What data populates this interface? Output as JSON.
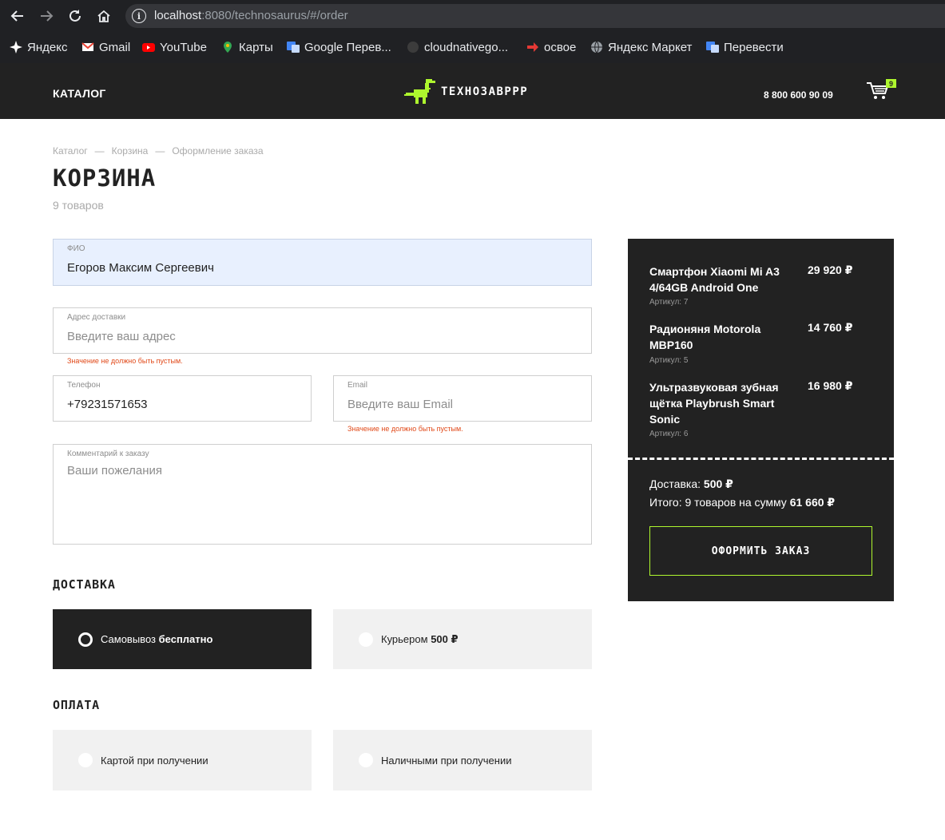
{
  "browser": {
    "url_host": "localhost",
    "url_rest": ":8080/technosaurus/#/order",
    "bookmarks": [
      "Яндекс",
      "Gmail",
      "YouTube",
      "Карты",
      "Google Перев...",
      "cloudnativego...",
      "освое",
      "Яндекс Маркет",
      "Перевести"
    ]
  },
  "header": {
    "catalog": "КАТАЛОГ",
    "logo_text": "ТЕХНОЗАВРРР",
    "phone": "8 800 600 90 09",
    "cart_count": "9"
  },
  "breadcrumb": [
    "Каталог",
    "Корзина",
    "Оформление заказа"
  ],
  "breadcrumb_sep": "—",
  "page": {
    "title": "КОРЗИНА",
    "count": "9 товаров"
  },
  "form": {
    "fio": {
      "label": "ФИО",
      "value": "Егоров Максим Сергеевич",
      "placeholder": ""
    },
    "address": {
      "label": "Адрес доставки",
      "value": "",
      "placeholder": "Введите ваш адрес",
      "error": "Значение не должно быть пустым."
    },
    "phone": {
      "label": "Телефон",
      "value": "+79231571653",
      "placeholder": ""
    },
    "email": {
      "label": "Email",
      "value": "",
      "placeholder": "Введите ваш Email",
      "error": "Значение не должно быть пустым."
    },
    "comment": {
      "label": "Комментарий к заказу",
      "value": "",
      "placeholder": "Ваши пожелания"
    }
  },
  "delivery": {
    "title": "ДОСТАВКА",
    "options": [
      {
        "label": "Самовывоз",
        "price": "бесплатно",
        "selected": true
      },
      {
        "label": "Курьером",
        "price": "500 ₽",
        "selected": false
      }
    ]
  },
  "payment": {
    "title": "ОПЛАТА",
    "options": [
      {
        "label": "Картой при получении",
        "selected": false
      },
      {
        "label": "Наличными при получении",
        "selected": false
      }
    ]
  },
  "summary": {
    "items": [
      {
        "name": "Смартфон Xiaomi Mi A3 4/64GB Android One",
        "price": "29 920 ₽",
        "article": "Артикул: 7"
      },
      {
        "name": "Радионяня Motorola MBP160",
        "price": "14 760 ₽",
        "article": "Артикул: 5"
      },
      {
        "name": "Ультразвуковая зубная щётка Playbrush Smart Sonic",
        "price": "16 980 ₽",
        "article": "Артикул: 6"
      }
    ],
    "delivery_label": "Доставка:",
    "delivery_value": "500 ₽",
    "total_label": "Итого: 9 товаров на сумму",
    "total_value": "61 660 ₽",
    "order_button": "ОФОРМИТЬ ЗАКАЗ"
  }
}
